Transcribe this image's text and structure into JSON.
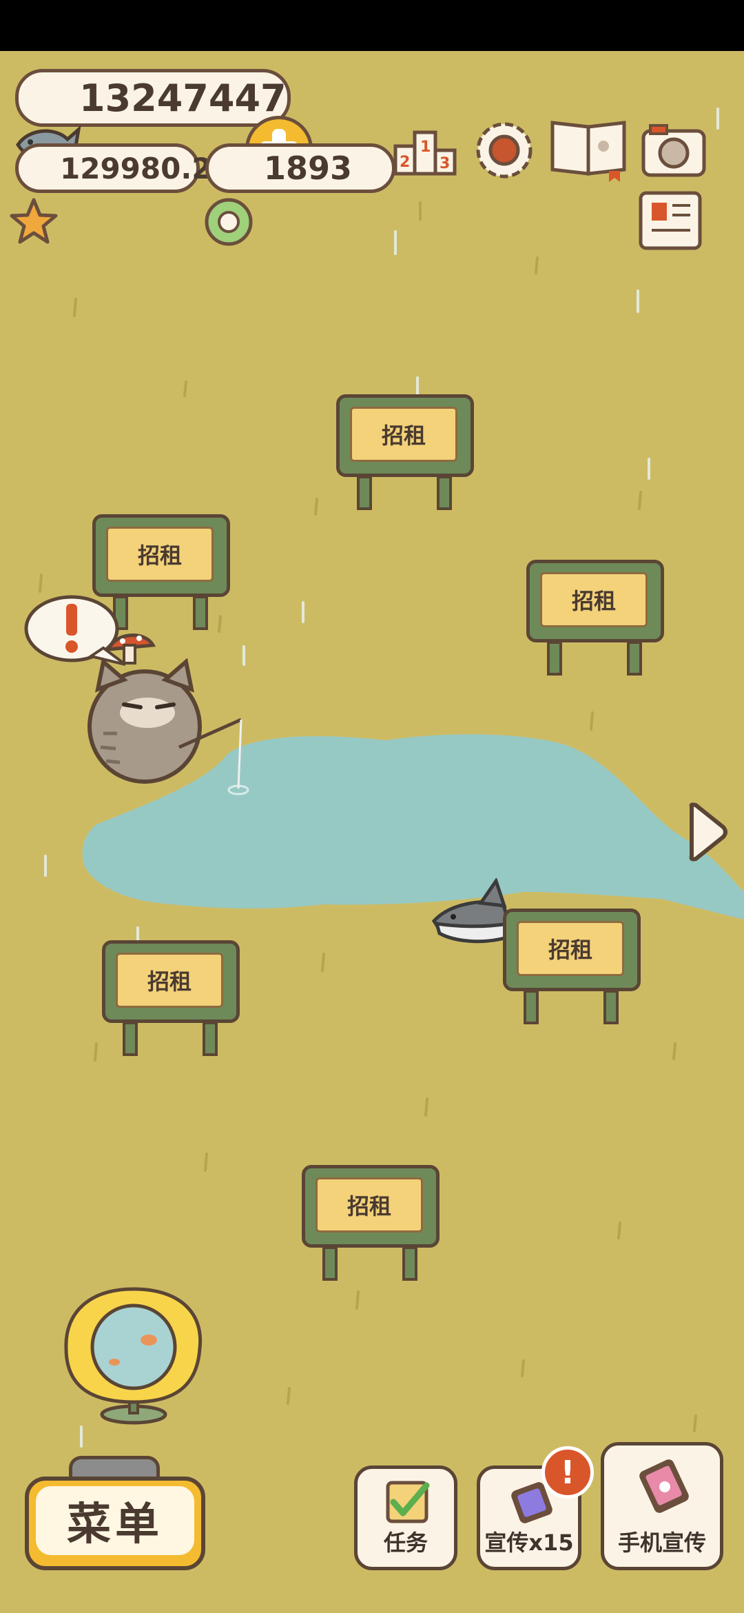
{
  "resources": {
    "fish": "13247447",
    "stars": "129980.2",
    "coins": "1893"
  },
  "signs": [
    {
      "label": "招租"
    },
    {
      "label": "招租"
    },
    {
      "label": "招租"
    },
    {
      "label": "招租"
    },
    {
      "label": "招租"
    },
    {
      "label": "招租"
    }
  ],
  "bottom_bar": {
    "menu_label": "菜单",
    "task_label": "任务",
    "promo_label": "宣传x15",
    "phone_promo_label": "手机宣传",
    "alert_mark": "!"
  },
  "colors": {
    "grass": "#cdbb64",
    "pond": "#97c9c4",
    "accent_yellow": "#f4bb30",
    "alert": "#d9562b",
    "outline": "#5a4535"
  }
}
